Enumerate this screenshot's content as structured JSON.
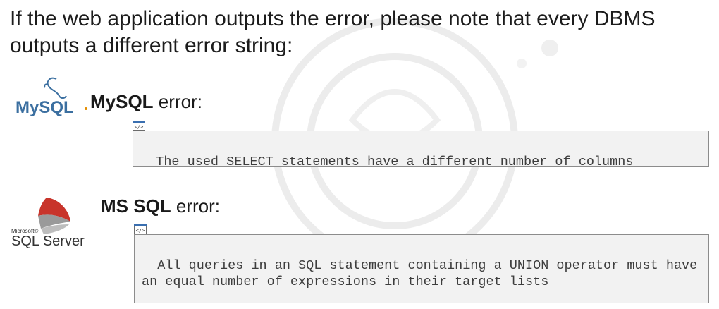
{
  "intro_text": "If the web application outputs the error, please note that every DBMS outputs a different error string:",
  "mysql": {
    "logo_text": "MySQL",
    "heading_bold": "MySQL",
    "heading_rest": " error:",
    "code_tab": "</>",
    "error_text": "The used SELECT statements have a different number of columns"
  },
  "mssql": {
    "logo_small": "Microsoft®",
    "logo_text": "SQL Server",
    "heading_bold": "MS SQL",
    "heading_rest": " error:",
    "code_tab": "</>",
    "error_text": "All queries in an SQL statement containing a UNION operator must have an equal number of expressions in their target lists"
  },
  "colors": {
    "mysql_blue": "#3b6fa0",
    "mysql_orange": "#e48e00",
    "mssql_red": "#c8342b",
    "code_bg": "#f2f2f2",
    "tab_accent": "#3a6fb0"
  }
}
